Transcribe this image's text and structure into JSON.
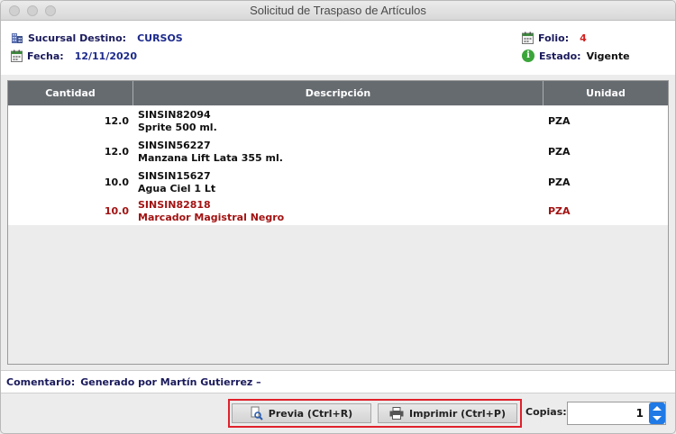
{
  "window": {
    "title": "Solicitud de Traspaso de Artículos"
  },
  "header": {
    "sucursal_label": "Sucursal Destino:",
    "sucursal_value": "CURSOS",
    "fecha_label": "Fecha:",
    "fecha_value": "12/11/2020",
    "folio_label": "Folio:",
    "folio_value": "4",
    "estado_label": "Estado:",
    "estado_value": "Vigente"
  },
  "table": {
    "columns": [
      "Cantidad",
      "Descripción",
      "Unidad"
    ],
    "rows": [
      {
        "cantidad": "12.0",
        "codigo": "SINSIN82094",
        "descripcion": "Sprite 500 ml.",
        "unidad": "PZA",
        "highlighted": false
      },
      {
        "cantidad": "12.0",
        "codigo": "SINSIN56227",
        "descripcion": "Manzana Lift Lata 355 ml.",
        "unidad": "PZA",
        "highlighted": false
      },
      {
        "cantidad": "10.0",
        "codigo": "SINSIN15627",
        "descripcion": "Agua Ciel 1 Lt",
        "unidad": "PZA",
        "highlighted": false
      },
      {
        "cantidad": "10.0",
        "codigo": "SINSIN82818",
        "descripcion": "Marcador Magistral Negro",
        "unidad": "PZA",
        "highlighted": true
      }
    ]
  },
  "comment": {
    "label": "Comentario:",
    "value": "Generado por Martín Gutierrez –"
  },
  "actions": {
    "preview_label": "Previa (Ctrl+R)",
    "print_label": "Imprimir (Ctrl+P)",
    "copies_label": "Copias:",
    "copies_value": "1"
  },
  "colors": {
    "header_blue": "#1c2a8c",
    "folio_red": "#d61f1f",
    "highlight_row": "#a31212",
    "table_header": "#666b70",
    "annotation_box": "#e0212b",
    "spinner_blue": "#1f7ae6"
  },
  "icons": {
    "sucursal": "building-icon",
    "fecha": "calendar-icon",
    "folio": "calendar-icon",
    "estado": "info-icon",
    "preview": "magnifier-document-icon",
    "print": "printer-icon"
  }
}
